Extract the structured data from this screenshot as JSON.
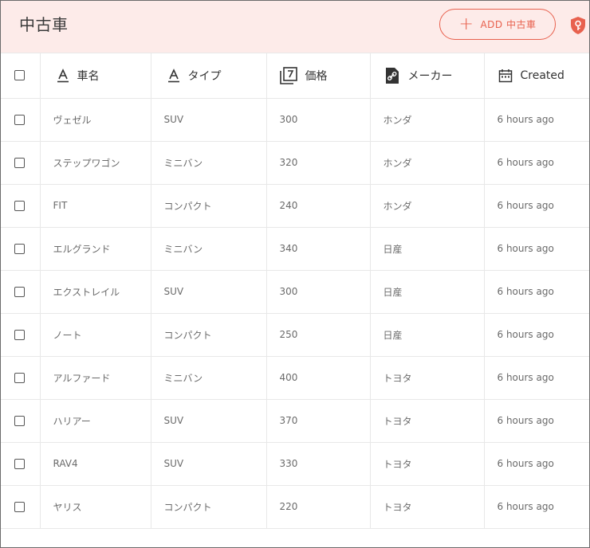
{
  "header": {
    "title": "中古車",
    "add_label": "ADD 中古車"
  },
  "colors": {
    "header_bg": "#fdebe9",
    "accent": "#e8614e"
  },
  "columns": [
    {
      "label": "車名",
      "icon": "text-type-icon"
    },
    {
      "label": "タイプ",
      "icon": "text-type-icon"
    },
    {
      "label": "価格",
      "icon": "number-type-icon"
    },
    {
      "label": "メーカー",
      "icon": "relation-link-icon"
    },
    {
      "label": "Created",
      "icon": "calendar-icon"
    }
  ],
  "rows": [
    {
      "name": "ヴェゼル",
      "type": "SUV",
      "price": "300",
      "maker": "ホンダ",
      "created": "6 hours ago"
    },
    {
      "name": "ステップワゴン",
      "type": "ミニバン",
      "price": "320",
      "maker": "ホンダ",
      "created": "6 hours ago"
    },
    {
      "name": "FIT",
      "type": "コンパクト",
      "price": "240",
      "maker": "ホンダ",
      "created": "6 hours ago"
    },
    {
      "name": "エルグランド",
      "type": "ミニバン",
      "price": "340",
      "maker": "日産",
      "created": "6 hours ago"
    },
    {
      "name": "エクストレイル",
      "type": "SUV",
      "price": "300",
      "maker": "日産",
      "created": "6 hours ago"
    },
    {
      "name": "ノート",
      "type": "コンパクト",
      "price": "250",
      "maker": "日産",
      "created": "6 hours ago"
    },
    {
      "name": "アルファード",
      "type": "ミニバン",
      "price": "400",
      "maker": "トヨタ",
      "created": "6 hours ago"
    },
    {
      "name": "ハリアー",
      "type": "SUV",
      "price": "370",
      "maker": "トヨタ",
      "created": "6 hours ago"
    },
    {
      "name": "RAV4",
      "type": "SUV",
      "price": "330",
      "maker": "トヨタ",
      "created": "6 hours ago"
    },
    {
      "name": "ヤリス",
      "type": "コンパクト",
      "price": "220",
      "maker": "トヨタ",
      "created": "6 hours ago"
    }
  ]
}
